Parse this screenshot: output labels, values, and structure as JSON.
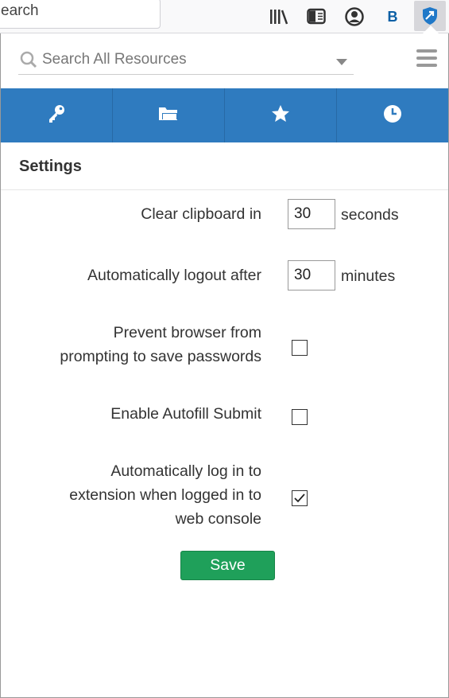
{
  "browser": {
    "url_text": "earch",
    "icons": [
      "library-icon",
      "reader-view-icon",
      "account-icon",
      "bold-b-icon",
      "extension-shield-icon"
    ],
    "bold_label": "B"
  },
  "search": {
    "placeholder": "Search All Resources"
  },
  "tabs": [
    {
      "icon": "key-icon"
    },
    {
      "icon": "folder-icon"
    },
    {
      "icon": "star-icon"
    },
    {
      "icon": "clock-icon"
    }
  ],
  "settings": {
    "title": "Settings",
    "clear_clipboard": {
      "label": "Clear clipboard in",
      "value": "30",
      "unit": "seconds"
    },
    "auto_logout": {
      "label": "Automatically logout after",
      "value": "30",
      "unit": "minutes"
    },
    "prevent_prompt": {
      "label_line1": "Prevent browser from",
      "label_line2": "prompting to save passwords",
      "checked": false
    },
    "autofill_submit": {
      "label": "Enable Autofill Submit",
      "checked": false
    },
    "auto_login": {
      "label_line1": "Automatically log in to",
      "label_line2": "extension when logged in to",
      "label_line3": "web console",
      "checked": true
    },
    "save_label": "Save"
  },
  "colors": {
    "tab_bar": "#2f7bbf",
    "save_button": "#1fa05a"
  }
}
